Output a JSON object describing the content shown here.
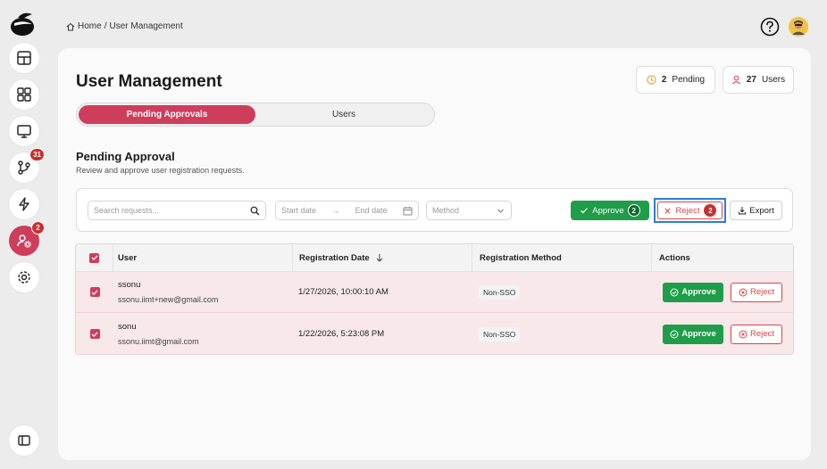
{
  "breadcrumb": {
    "home": "Home",
    "separator": "/",
    "current": "User Management"
  },
  "sidebar": {
    "badges": {
      "pull_requests": "31",
      "user_settings": "2"
    }
  },
  "header": {
    "title": "User Management",
    "pending_count": "2",
    "pending_label": "Pending",
    "users_count": "27",
    "users_label": "Users"
  },
  "tabs": [
    {
      "label": "Pending Approvals",
      "active": true
    },
    {
      "label": "Users",
      "active": false
    }
  ],
  "section": {
    "title": "Pending Approval",
    "subtitle": "Review and approve user registration requests."
  },
  "filters": {
    "search_placeholder": "Search requests...",
    "start_date_placeholder": "Start date",
    "arrow": "→",
    "end_date_placeholder": "End date",
    "method_placeholder": "Method",
    "approve_label": "Approve",
    "approve_count": "2",
    "reject_label": "Reject",
    "reject_count": "2",
    "export_label": "Export"
  },
  "table": {
    "headers": {
      "user": "User",
      "registration_date": "Registration Date",
      "registration_method": "Registration Method",
      "actions": "Actions"
    },
    "rows": [
      {
        "name": "ssonu",
        "email": "ssonu.iimt+new@gmail.com",
        "date": "1/27/2026, 10:00:10 AM",
        "method": "Non-SSO",
        "approve": "Approve",
        "reject": "Reject"
      },
      {
        "name": "sonu",
        "email": "ssonu.iimt@gmail.com",
        "date": "1/22/2026, 5:23:08 PM",
        "method": "Non-SSO",
        "approve": "Approve",
        "reject": "Reject"
      }
    ]
  },
  "colors": {
    "accent": "#cf3d5d",
    "approve": "#1f9d4a",
    "reject": "#dd4444",
    "focus_ring": "#2b7ed4"
  }
}
